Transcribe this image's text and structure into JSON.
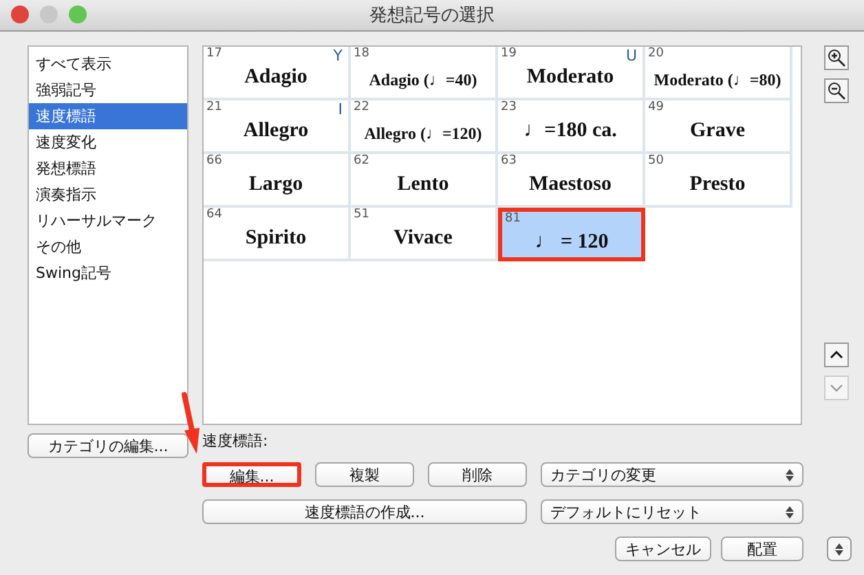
{
  "window": {
    "title": "発想記号の選択"
  },
  "categories": [
    {
      "label": "すべて表示",
      "selected": false
    },
    {
      "label": "強弱記号",
      "selected": false
    },
    {
      "label": "速度標語",
      "selected": true
    },
    {
      "label": "速度変化",
      "selected": false
    },
    {
      "label": "発想標語",
      "selected": false
    },
    {
      "label": "演奏指示",
      "selected": false
    },
    {
      "label": "リハーサルマーク",
      "selected": false
    },
    {
      "label": "その他",
      "selected": false
    },
    {
      "label": "Swing記号",
      "selected": false
    }
  ],
  "cells": [
    {
      "number": "17",
      "shortcut": "Y",
      "text": "Adagio",
      "selected": false,
      "highlighted": false
    },
    {
      "number": "18",
      "text": "Adagio (♩=40)",
      "selected": false,
      "highlighted": false
    },
    {
      "number": "19",
      "shortcut": "U",
      "text": "Moderato",
      "selected": false,
      "highlighted": false
    },
    {
      "number": "20",
      "text": "Moderato (♩=80)",
      "selected": false,
      "highlighted": false
    },
    {
      "number": "21",
      "shortcut": "I",
      "text": "Allegro",
      "selected": false,
      "highlighted": false
    },
    {
      "number": "22",
      "text": "Allegro (♩=120)",
      "selected": false,
      "highlighted": false
    },
    {
      "number": "23",
      "text": "♩=180 ca.",
      "selected": false,
      "highlighted": false
    },
    {
      "number": "49",
      "text": "Grave",
      "selected": false,
      "highlighted": false
    },
    {
      "number": "66",
      "text": "Largo",
      "selected": false,
      "highlighted": false
    },
    {
      "number": "62",
      "text": "Lento",
      "selected": false,
      "highlighted": false
    },
    {
      "number": "63",
      "text": "Maestoso",
      "selected": false,
      "highlighted": false
    },
    {
      "number": "50",
      "text": "Presto",
      "selected": false,
      "highlighted": false
    },
    {
      "number": "64",
      "text": "Spirito",
      "selected": false,
      "highlighted": false
    },
    {
      "number": "51",
      "text": "Vivace",
      "selected": false,
      "highlighted": false
    },
    {
      "number": "81",
      "text": "♩ = 120",
      "selected": true,
      "highlighted": true
    }
  ],
  "edit_category_button": "カテゴリの編集...",
  "section_label": "速度標語:",
  "actions": [
    {
      "label": "編集...",
      "highlighted": true
    },
    {
      "label": "複製",
      "highlighted": false
    },
    {
      "label": "削除",
      "highlighted": false
    }
  ],
  "change_category_popup": "カテゴリの変更",
  "create_button": "速度標語の作成...",
  "reset_popup": "デフォルトにリセット",
  "cancel_button": "キャンセル",
  "place_button": "配置"
}
